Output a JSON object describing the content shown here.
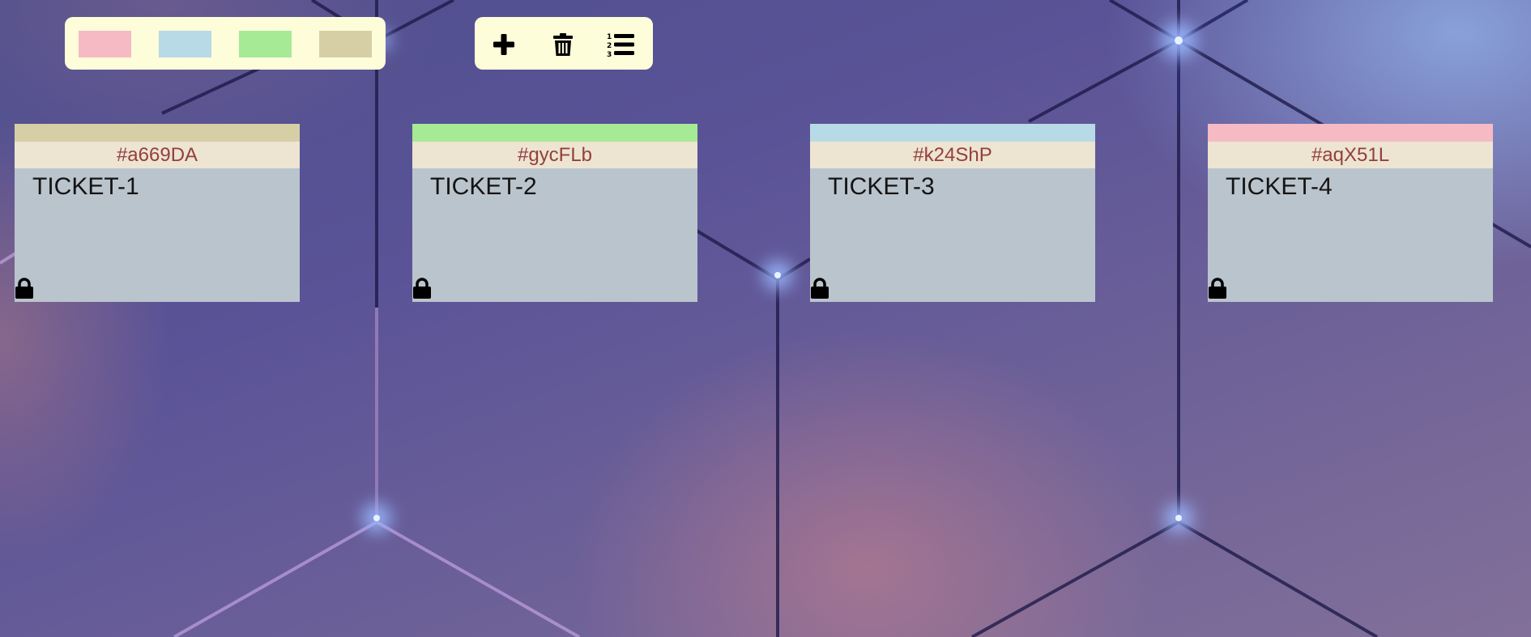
{
  "background": {
    "base_color": "#5a5397",
    "line_color": "#1e1a4a",
    "glow_color": "#9ab8ff"
  },
  "palette": {
    "swatches": [
      {
        "name": "pink",
        "color": "#f6bac5"
      },
      {
        "name": "light-blue",
        "color": "#b8d9e6"
      },
      {
        "name": "light-green",
        "color": "#a6ea95"
      },
      {
        "name": "khaki",
        "color": "#d6cfa6"
      }
    ],
    "background_color": "#fdfdda"
  },
  "toolbar": {
    "buttons": [
      {
        "name": "add",
        "icon": "plus-icon"
      },
      {
        "name": "delete",
        "icon": "trash-icon"
      },
      {
        "name": "ordered-list",
        "icon": "ordered-list-icon"
      }
    ]
  },
  "tickets": [
    {
      "id": "#a669DA",
      "title": "TICKET-1",
      "color": "#d6cfa6",
      "locked": true
    },
    {
      "id": "#gycFLb",
      "title": "TICKET-2",
      "color": "#a6ea95",
      "locked": true
    },
    {
      "id": "#k24ShP",
      "title": "TICKET-3",
      "color": "#b8d9e6",
      "locked": true
    },
    {
      "id": "#aqX51L",
      "title": "TICKET-4",
      "color": "#f6bac5",
      "locked": true
    }
  ]
}
